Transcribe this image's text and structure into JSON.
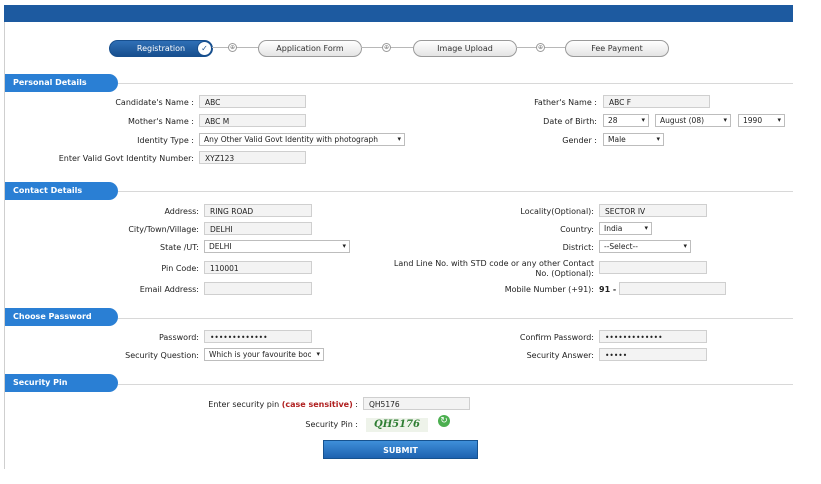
{
  "steps": [
    {
      "label": "Registration",
      "check": "✓"
    },
    {
      "label": "Application Form"
    },
    {
      "label": "Image Upload"
    },
    {
      "label": "Fee Payment"
    }
  ],
  "step_connector_icon": "⊕",
  "sections": {
    "personal": "Personal Details",
    "contact": "Contact Details",
    "password": "Choose Password",
    "pin": "Security Pin"
  },
  "personal": {
    "candidate_name_label": "Candidate's Name :",
    "candidate_name": "ABC",
    "mother_name_label": "Mother's Name :",
    "mother_name": "ABC M",
    "identity_type_label": "Identity Type :",
    "identity_type": "Any Other Valid Govt Identity with photograph",
    "identity_number_label": "Enter Valid Govt Identity Number:",
    "identity_number": "XYZ123",
    "father_name_label": "Father's Name :",
    "father_name": "ABC F",
    "dob_label": "Date of Birth:",
    "dob_day": "28",
    "dob_month": "August (08)",
    "dob_year": "1990",
    "gender_label": "Gender :",
    "gender": "Male"
  },
  "contact": {
    "address_label": "Address:",
    "address": "RING ROAD",
    "city_label": "City/Town/Village:",
    "city": "DELHI",
    "state_label": "State /UT:",
    "state": "DELHI",
    "pin_label": "Pin Code:",
    "pin": "110001",
    "email_label": "Email Address:",
    "email": "",
    "locality_label": "Locality(Optional):",
    "locality": "SECTOR IV",
    "country_label": "Country:",
    "country": "India",
    "district_label": "District:",
    "district": "--Select--",
    "landline_label_1": "Land Line No. with STD code or any other Contact",
    "landline_label_2": "No. (Optional):",
    "landline": "",
    "mobile_label": "Mobile Number (+91):",
    "mobile_prefix": "91 -",
    "mobile": ""
  },
  "password": {
    "password_label": "Password:",
    "password": "•••••••••••••",
    "question_label": "Security Question:",
    "question": "Which is your favourite book",
    "confirm_label": "Confirm Password:",
    "confirm": "•••••••••••••",
    "answer_label": "Security Answer:",
    "answer": "•••••"
  },
  "pin": {
    "enter_label_a": "Enter security pin ",
    "enter_label_b": "(case sensitive)",
    "enter_label_c": " :",
    "entered": "QH5176",
    "pin_label": "Security Pin :",
    "captcha": "QH5176",
    "refresh_icon": "↻"
  },
  "submit_label": "SUBMIT",
  "dropdown_arrow": "▾",
  "colors": {
    "accent": "#2a7fd4",
    "topbar": "#1d5aa0",
    "captcha": "#2e7d32"
  }
}
